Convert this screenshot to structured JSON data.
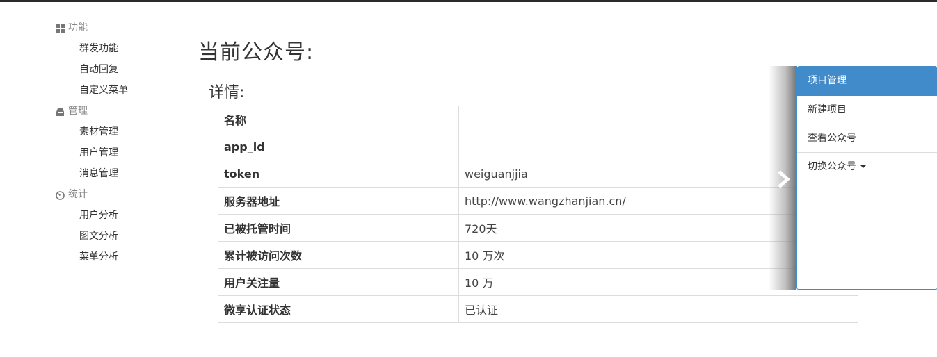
{
  "sidebar": {
    "sections": [
      {
        "title": "功能",
        "icon": "grid-icon",
        "items": [
          "群发功能",
          "自动回复",
          "自定义菜单"
        ]
      },
      {
        "title": "管理",
        "icon": "inbox-icon",
        "items": [
          "素材管理",
          "用户管理",
          "消息管理"
        ]
      },
      {
        "title": "统计",
        "icon": "dashboard-icon",
        "items": [
          "用户分析",
          "图文分析",
          "菜单分析"
        ]
      }
    ]
  },
  "main": {
    "title": "当前公众号:",
    "subtitle": "详情:",
    "details": [
      {
        "key": "名称",
        "value": ""
      },
      {
        "key": "app_id",
        "value": ""
      },
      {
        "key": "token",
        "value": "weiguanjjia"
      },
      {
        "key": "服务器地址",
        "value": "http://www.wangzhanjian.cn/"
      },
      {
        "key": "已被托管时间",
        "value": "720天"
      },
      {
        "key": "累计被访问次数",
        "value": "10 万次"
      },
      {
        "key": "用户关注量",
        "value": "10 万"
      },
      {
        "key": "微享认证状态",
        "value": "已认证"
      }
    ]
  },
  "right_menu": {
    "header": "项目管理",
    "items": [
      "新建项目",
      "查看公众号",
      "切换公众号"
    ]
  },
  "colors": {
    "accent": "#428bca",
    "border": "#dddddd"
  }
}
